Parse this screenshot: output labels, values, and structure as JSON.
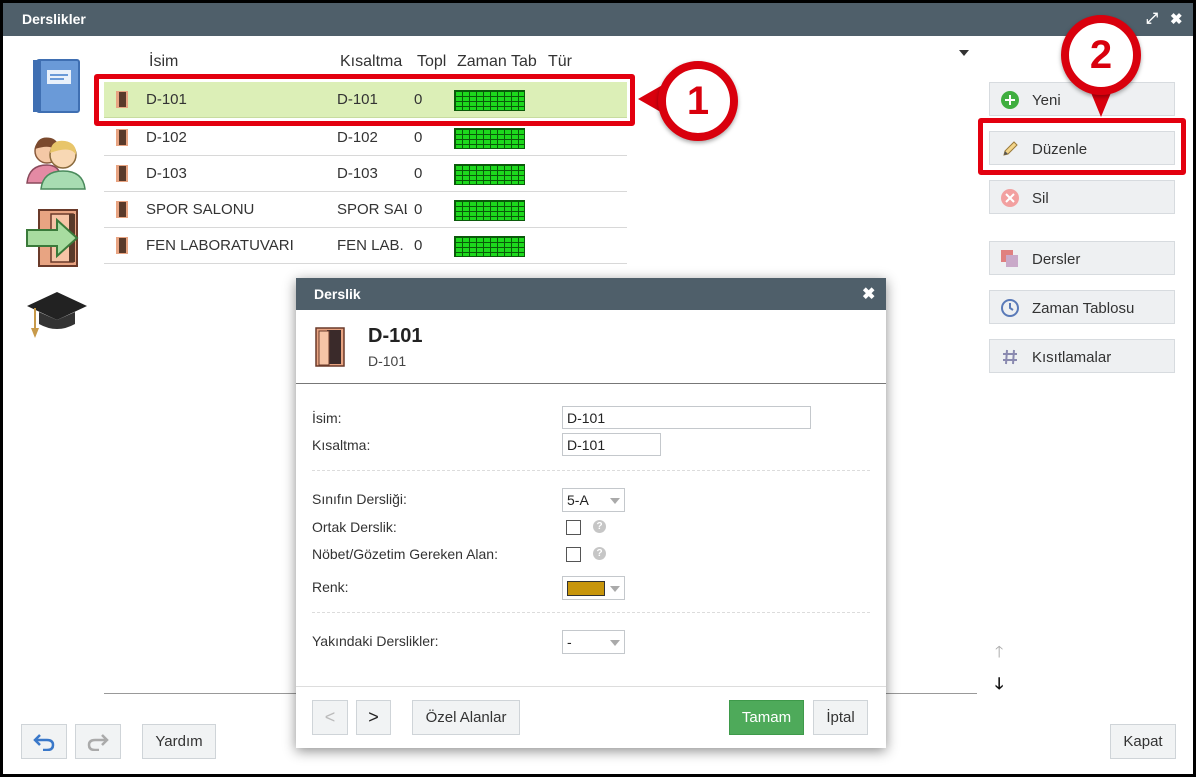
{
  "window": {
    "title": "Derslikler"
  },
  "columns": {
    "name": "İsim",
    "short": "Kısaltma",
    "total": "Topl",
    "timetable": "Zaman Tab",
    "type": "Tür"
  },
  "rows": [
    {
      "name": "D-101",
      "short": "D-101",
      "total": "0"
    },
    {
      "name": "D-102",
      "short": "D-102",
      "total": "0"
    },
    {
      "name": "D-103",
      "short": "D-103",
      "total": "0"
    },
    {
      "name": "SPOR SALONU",
      "short": "SPOR SAL",
      "total": "0"
    },
    {
      "name": "FEN LABORATUVARI",
      "short": "FEN LAB.",
      "total": "0"
    }
  ],
  "callouts": {
    "one": "1",
    "two": "2"
  },
  "actions": {
    "new": "Yeni",
    "edit": "Düzenle",
    "delete": "Sil",
    "courses": "Dersler",
    "timetable": "Zaman Tablosu",
    "constraints": "Kısıtlamalar"
  },
  "bottom": {
    "help": "Yardım",
    "close": "Kapat"
  },
  "dialog": {
    "title": "Derslik",
    "header_name": "D-101",
    "header_short": "D-101",
    "name_label": "İsim:",
    "name_value": "D-101",
    "short_label": "Kısaltma:",
    "short_value": "D-101",
    "class_room_label": "Sınıfın Dersliği:",
    "class_room_value": "5-A",
    "shared_label": "Ortak Derslik:",
    "duty_label": "Nöbet/Gözetim Gereken Alan:",
    "color_label": "Renk:",
    "color_value": "#c8960c",
    "nearby_label": "Yakındaki Derslikler:",
    "nearby_value": "-",
    "prev": "<",
    "next": ">",
    "custom_fields": "Özel Alanlar",
    "ok": "Tamam",
    "cancel": "İptal"
  }
}
